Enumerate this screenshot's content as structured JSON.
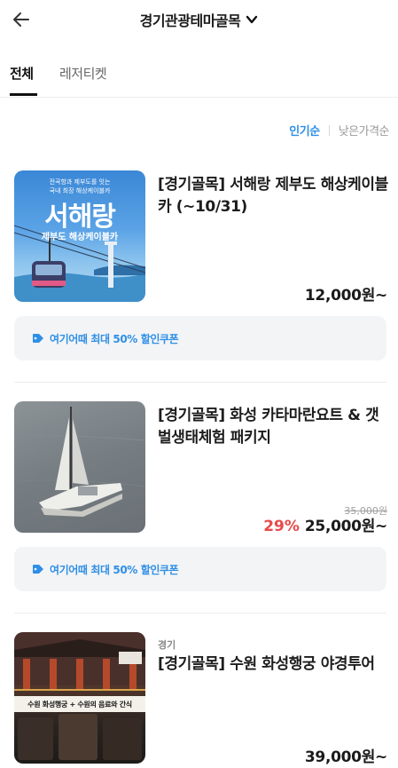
{
  "header": {
    "back_icon": "arrow-left-icon",
    "title": "경기관광테마골목",
    "dropdown_icon": "chevron-down-icon"
  },
  "tabs": [
    {
      "label": "전체",
      "active": true
    },
    {
      "label": "레저티켓",
      "active": false
    }
  ],
  "sort": {
    "options": [
      "인기순",
      "낮은가격순"
    ],
    "active": "인기순",
    "active_color": "#2f8fe6"
  },
  "products": [
    {
      "title": "[경기골목] 서해랑 제부도 해상케이블카 (~10/31)",
      "price": "12,000원~",
      "coupon": "여기어때 최대 50% 할인쿠폰",
      "thumb_overlay": {
        "tagline1": "전곡항과 제부도를 잇는",
        "tagline2": "국내 최장 해상케이블카",
        "name": "서해랑",
        "subtitle": "제부도 해상케이블카"
      }
    },
    {
      "title": "[경기골목] 화성 카타마란요트 & 갯벌생태체험 패키지",
      "discount": "29%",
      "original_price": "35,000원",
      "price": "25,000원~",
      "coupon": "여기어때 최대 50% 할인쿠폰"
    },
    {
      "region": "경기",
      "title": "[경기골목] 수원 화성행궁 야경투어",
      "price": "39,000원~",
      "thumb_overlay": {
        "banner": "수원 화성행궁 + 수원의 음료와 간식"
      }
    }
  ],
  "colors": {
    "accent": "#2f8fe6",
    "discount": "#e84a4a",
    "coupon_bg": "#f3f4f6"
  }
}
